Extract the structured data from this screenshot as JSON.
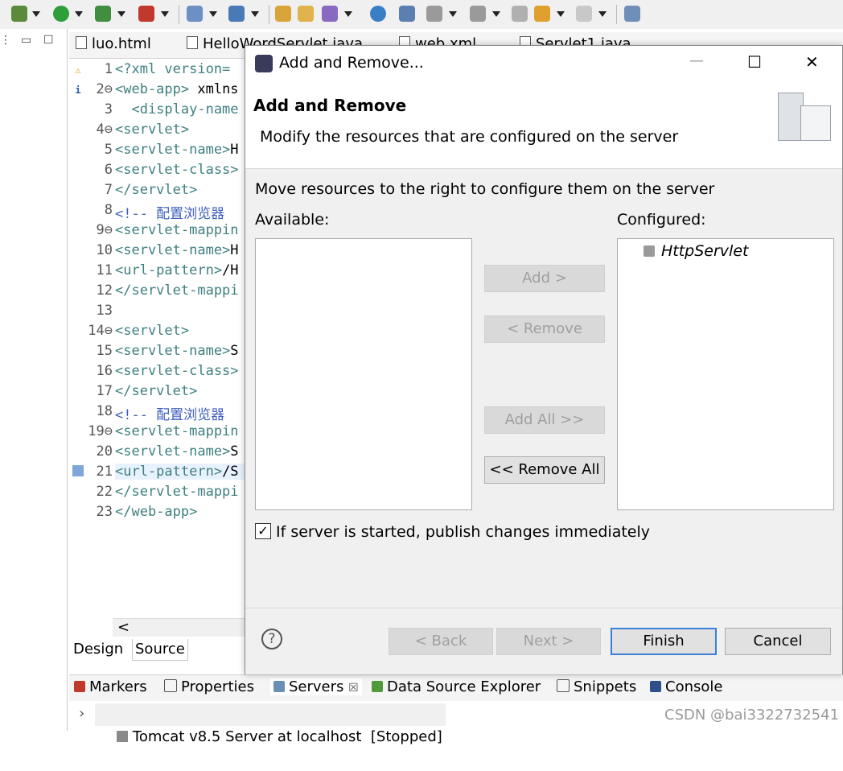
{
  "editor": {
    "tabs": [
      "luo.html",
      "HelloWordServlet.java",
      "web.xml",
      "Servlet1.java"
    ],
    "lines": [
      {
        "num": "1",
        "parts": [
          [
            "tag",
            "<?xml version="
          ]
        ]
      },
      {
        "num": "2⊖",
        "parts": [
          [
            "tag",
            "<web-app> "
          ],
          [
            "txt",
            "xmlns"
          ]
        ]
      },
      {
        "num": "3",
        "parts": [
          [
            "tag",
            "  <display-name"
          ]
        ]
      },
      {
        "num": "4⊖",
        "parts": [
          [
            "tag",
            "<servlet>"
          ]
        ]
      },
      {
        "num": "5",
        "parts": [
          [
            "tag",
            "<servlet-name>"
          ],
          [
            "txt",
            "H"
          ]
        ]
      },
      {
        "num": "6",
        "parts": [
          [
            "tag",
            "<servlet-class>"
          ]
        ]
      },
      {
        "num": "7",
        "parts": [
          [
            "tag",
            "</servlet>"
          ]
        ]
      },
      {
        "num": "8",
        "parts": [
          [
            "cmt",
            "<!-- 配置浏览器"
          ]
        ]
      },
      {
        "num": "9⊖",
        "parts": [
          [
            "tag",
            "<servlet-mappin"
          ]
        ]
      },
      {
        "num": "10",
        "parts": [
          [
            "tag",
            "<servlet-name>"
          ],
          [
            "txt",
            "H"
          ]
        ]
      },
      {
        "num": "11",
        "parts": [
          [
            "tag",
            "<url-pattern>"
          ],
          [
            "txt",
            "/H"
          ]
        ]
      },
      {
        "num": "12",
        "parts": [
          [
            "tag",
            "</servlet-mappi"
          ]
        ]
      },
      {
        "num": "13",
        "parts": []
      },
      {
        "num": "14⊖",
        "parts": [
          [
            "tag",
            "<servlet>"
          ]
        ]
      },
      {
        "num": "15",
        "parts": [
          [
            "tag",
            "<servlet-name>"
          ],
          [
            "txt",
            "S"
          ]
        ]
      },
      {
        "num": "16",
        "parts": [
          [
            "tag",
            "<servlet-class>"
          ]
        ]
      },
      {
        "num": "17",
        "parts": [
          [
            "tag",
            "</servlet>"
          ]
        ]
      },
      {
        "num": "18",
        "parts": [
          [
            "cmt",
            "<!-- 配置浏览器"
          ]
        ]
      },
      {
        "num": "19⊖",
        "parts": [
          [
            "tag",
            "<servlet-mappin"
          ]
        ]
      },
      {
        "num": "20",
        "parts": [
          [
            "tag",
            "<servlet-name>"
          ],
          [
            "txt",
            "S"
          ]
        ]
      },
      {
        "num": "21",
        "parts": [
          [
            "tag",
            "<url-pattern>"
          ],
          [
            "txt",
            "/S"
          ]
        ]
      },
      {
        "num": "22",
        "parts": [
          [
            "tag",
            "</servlet-mappi"
          ]
        ]
      },
      {
        "num": "23",
        "parts": [
          [
            "tag",
            "</web-app>"
          ]
        ]
      }
    ],
    "design_tab": "Design",
    "source_tab": "Source",
    "scroll_left": "<"
  },
  "views": {
    "tabs": [
      "Markers",
      "Properties",
      "Servers",
      "Data Source Explorer",
      "Snippets",
      "Console"
    ],
    "server_entry": "Tomcat v8.5 Server at localhost  [Stopped]",
    "watermark": "CSDN @bai3322732541"
  },
  "dialog": {
    "title": "Add and Remove...",
    "header_title": "Add and Remove",
    "header_desc": "Modify the resources that are configured on the server",
    "instruction": "Move resources to the right to configure them on the server",
    "available_label": "Available:",
    "configured_label": "Configured:",
    "configured_items": [
      "HttpServlet"
    ],
    "add": "Add >",
    "remove": "< Remove",
    "add_all": "Add All >>",
    "remove_all": "<< Remove All",
    "checkbox_label": "If server is started, publish changes immediately",
    "checkbox_checked": true,
    "back": "< Back",
    "next": "Next >",
    "finish": "Finish",
    "cancel": "Cancel",
    "help": "?",
    "minimize": "—",
    "maximize": "☐",
    "close": "✕"
  }
}
